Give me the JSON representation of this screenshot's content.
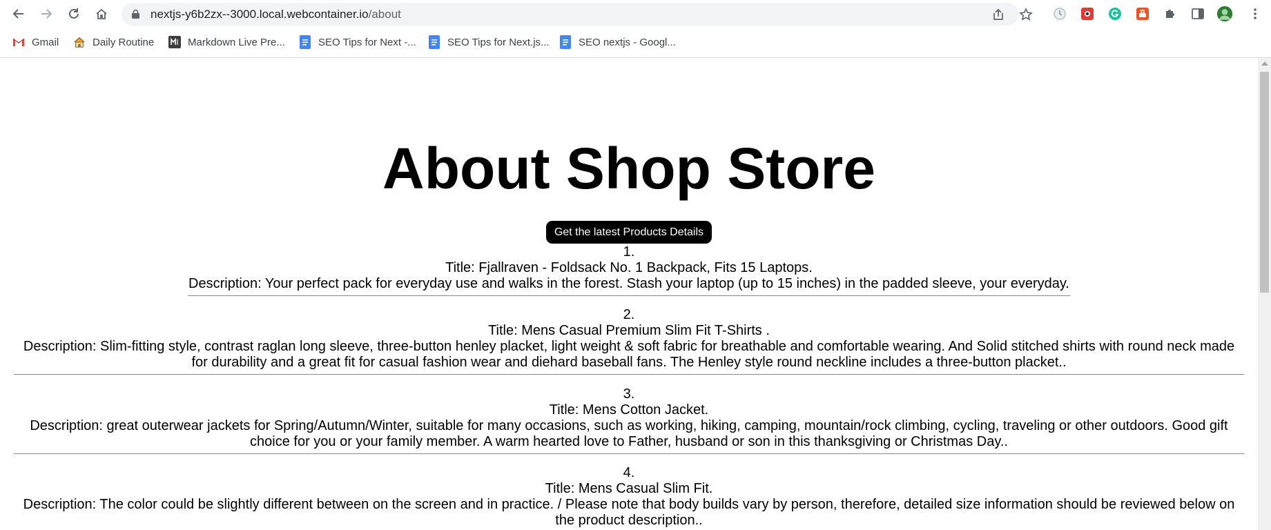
{
  "browser": {
    "url_host": "nextjs-y6b2zx--3000.local.webcontainer.io",
    "url_path": "/about"
  },
  "bookmarks": [
    {
      "label": "Gmail",
      "icon": "gmail-icon"
    },
    {
      "label": "Daily Routine",
      "icon": "house-icon"
    },
    {
      "label": "Markdown Live Pre...",
      "icon": "markdown-icon"
    },
    {
      "label": "SEO Tips for Next -...",
      "icon": "docs-icon"
    },
    {
      "label": "SEO Tips for Next.js...",
      "icon": "docs-icon"
    },
    {
      "label": "SEO nextjs - Googl...",
      "icon": "docs-icon"
    }
  ],
  "page": {
    "heading": "About Shop Store",
    "button_label": "Get the latest Products Details",
    "products": [
      {
        "number": "1.",
        "title": "Title: Fjallraven - Foldsack No. 1 Backpack, Fits 15 Laptops.",
        "description": "Description: Your perfect pack for everyday use and walks in the forest. Stash your laptop (up to 15 inches) in the padded sleeve, your everyday."
      },
      {
        "number": "2.",
        "title": "Title: Mens Casual Premium Slim Fit T-Shirts .",
        "description": "Description: Slim-fitting style, contrast raglan long sleeve, three-button henley placket, light weight & soft fabric for breathable and comfortable wearing. And Solid stitched shirts with round neck made for durability and a great fit for casual fashion wear and diehard baseball fans. The Henley style round neckline includes a three-button placket.."
      },
      {
        "number": "3.",
        "title": "Title: Mens Cotton Jacket.",
        "description": "Description: great outerwear jackets for Spring/Autumn/Winter, suitable for many occasions, such as working, hiking, camping, mountain/rock climbing, cycling, traveling or other outdoors. Good gift choice for you or your family member. A warm hearted love to Father, husband or son in this thanksgiving or Christmas Day.."
      },
      {
        "number": "4.",
        "title": "Title: Mens Casual Slim Fit.",
        "description": "Description: The color could be slightly different between on the screen and in practice. / Please note that body builds vary by person, therefore, detailed size information should be reviewed below on the product description.."
      }
    ]
  },
  "colors": {
    "button_bg": "#000000",
    "button_text": "#ffffff",
    "omnibox_bg": "#f1f3f4"
  }
}
